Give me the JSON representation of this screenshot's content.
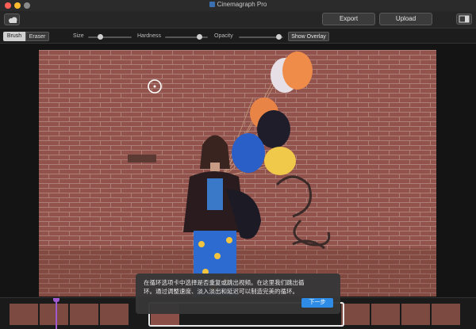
{
  "window": {
    "title": "Cinemagraph Pro"
  },
  "toolbar": {
    "export_label": "Export",
    "upload_label": "Upload"
  },
  "tools": {
    "brush_label": "Brush",
    "eraser_label": "Eraser",
    "size_label": "Size",
    "size_level": 0.25,
    "hardness_label": "Hardness",
    "hardness_level": 0.85,
    "opacity_label": "Opacity",
    "opacity_level": 0.95,
    "show_overlay_label": "Show Overlay"
  },
  "tooltip": {
    "text": "在循环选项卡中选择是否重复或跳出视频。在这里我们跳出循环。通过调整速度、淡入淡出和延迟可以制造完美的循环。",
    "next_label": "下一步"
  },
  "colors": {
    "accent": "#2e8ce6",
    "close": "#ff5f57",
    "minimize": "#febc2e",
    "zoom": "#9a9a9a",
    "playhead": "#a05ad0"
  }
}
